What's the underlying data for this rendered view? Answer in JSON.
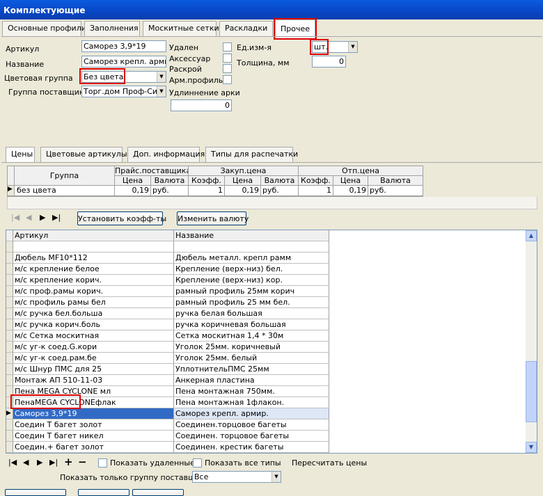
{
  "window": {
    "title": "Комплектующие"
  },
  "tabs": [
    "Основные профили",
    "Заполнения",
    "Москитные сетки",
    "Раскладки",
    "Прочее"
  ],
  "form": {
    "article_label": "Артикул",
    "article_value": "Саморез 3,9*19",
    "name_label": "Название",
    "name_value": "Саморез крепл. армир.",
    "color_group_label": "Цветовая группа",
    "color_group_value": "Без цвета",
    "supplier_group_label": "Группа поставщика",
    "supplier_group_value": "Торг.дом Проф-Сити",
    "deleted_label": "Удален",
    "accessory_label": "Аксессуар",
    "cutting_label": "Раскрой",
    "reinforcement_label": "Арм.профиль",
    "unit_label": "Ед.изм-я",
    "unit_value": "шт.",
    "thickness_label": "Толщина, мм",
    "thickness_value": "0",
    "arch_label": "Удлиннение арки",
    "arch_value": "0"
  },
  "subtabs": [
    "Цены",
    "Цветовые артикулы",
    "Доп. информация",
    "Типы для распечатки"
  ],
  "price_grid": {
    "group_header": "Группа",
    "supplier_price": "Прайс.поставщика",
    "purchase_price": "Закуп.цена",
    "sale_price": "Отп.цена",
    "sub": {
      "price": "Цена",
      "currency": "Валюта",
      "coef": "Коэфф."
    },
    "row": {
      "group": "без цвета",
      "sp_price": "0,19",
      "sp_cur": "руб.",
      "pp_coef": "1",
      "pp_price": "0,19",
      "pp_cur": "руб.",
      "op_coef": "1",
      "op_price": "0,19",
      "op_cur": "руб."
    }
  },
  "buttons": {
    "set_coef": "Установить коэфф-ты",
    "change_currency": "Изменить валюту"
  },
  "main_grid": {
    "col_article": "Артикул",
    "col_name": "Название",
    "rows": [
      {
        "a": "",
        "n": ""
      },
      {
        "a": "Дюбель MF10*112",
        "n": "Дюбель металл. крепл рамм"
      },
      {
        "a": "м/с крепление белое",
        "n": "Крепление (верх-низ) бел."
      },
      {
        "a": "м/с крепление корич.",
        "n": "Крепление (верх-низ) кор."
      },
      {
        "a": "м/с проф.рамы корич.",
        "n": "рамный профиль 25мм корич"
      },
      {
        "a": "м/с профиль рамы бел",
        "n": "рамный профиль 25 мм бел."
      },
      {
        "a": "м/с ручка бел.больша",
        "n": "ручка белая большая"
      },
      {
        "a": "м/с ручка корич.боль",
        "n": "ручка коричневая большая"
      },
      {
        "a": "м/с Сетка москитная",
        "n": "Сетка москитная 1,4 * 30м"
      },
      {
        "a": "м/с уг-к соед.G.кори",
        "n": "Уголок 25мм. коричневый"
      },
      {
        "a": "м/с уг-к соед.рам.бе",
        "n": "Уголок 25мм. белый"
      },
      {
        "a": "м/с Шнур ПМС для 25",
        "n": "УплотнительПМС 25мм"
      },
      {
        "a": "Монтаж АП 510-11-03",
        "n": "Анкерная пластина"
      },
      {
        "a": "Пена MEGA CYCLONE мл",
        "n": "Пена монтажная 750мм."
      },
      {
        "a": "ПенаMEGA CYCLONEфлак",
        "n": "Пена монтажная 1флакон."
      },
      {
        "a": "Саморез 3,9*19",
        "n": "Саморез крепл. армир."
      },
      {
        "a": "Соедин Т багет золот",
        "n": "Соединен.торцовое багеты"
      },
      {
        "a": "Соедин Т багет никел",
        "n": "Соединен. торцовое багеты"
      },
      {
        "a": "Соедин.+ багет золот",
        "n": "Соединен. крестик багеты"
      },
      {
        "a": "Соедин.+ багет.никел",
        "n": "Соединен. крестик багеты"
      }
    ]
  },
  "bottom": {
    "show_deleted": "Показать удаленные",
    "show_all_types": "Показать все типы",
    "recalc": "Пересчитать цены",
    "supplier_filter_label": "Показать только группу поставщика",
    "supplier_filter_value": "Все"
  }
}
